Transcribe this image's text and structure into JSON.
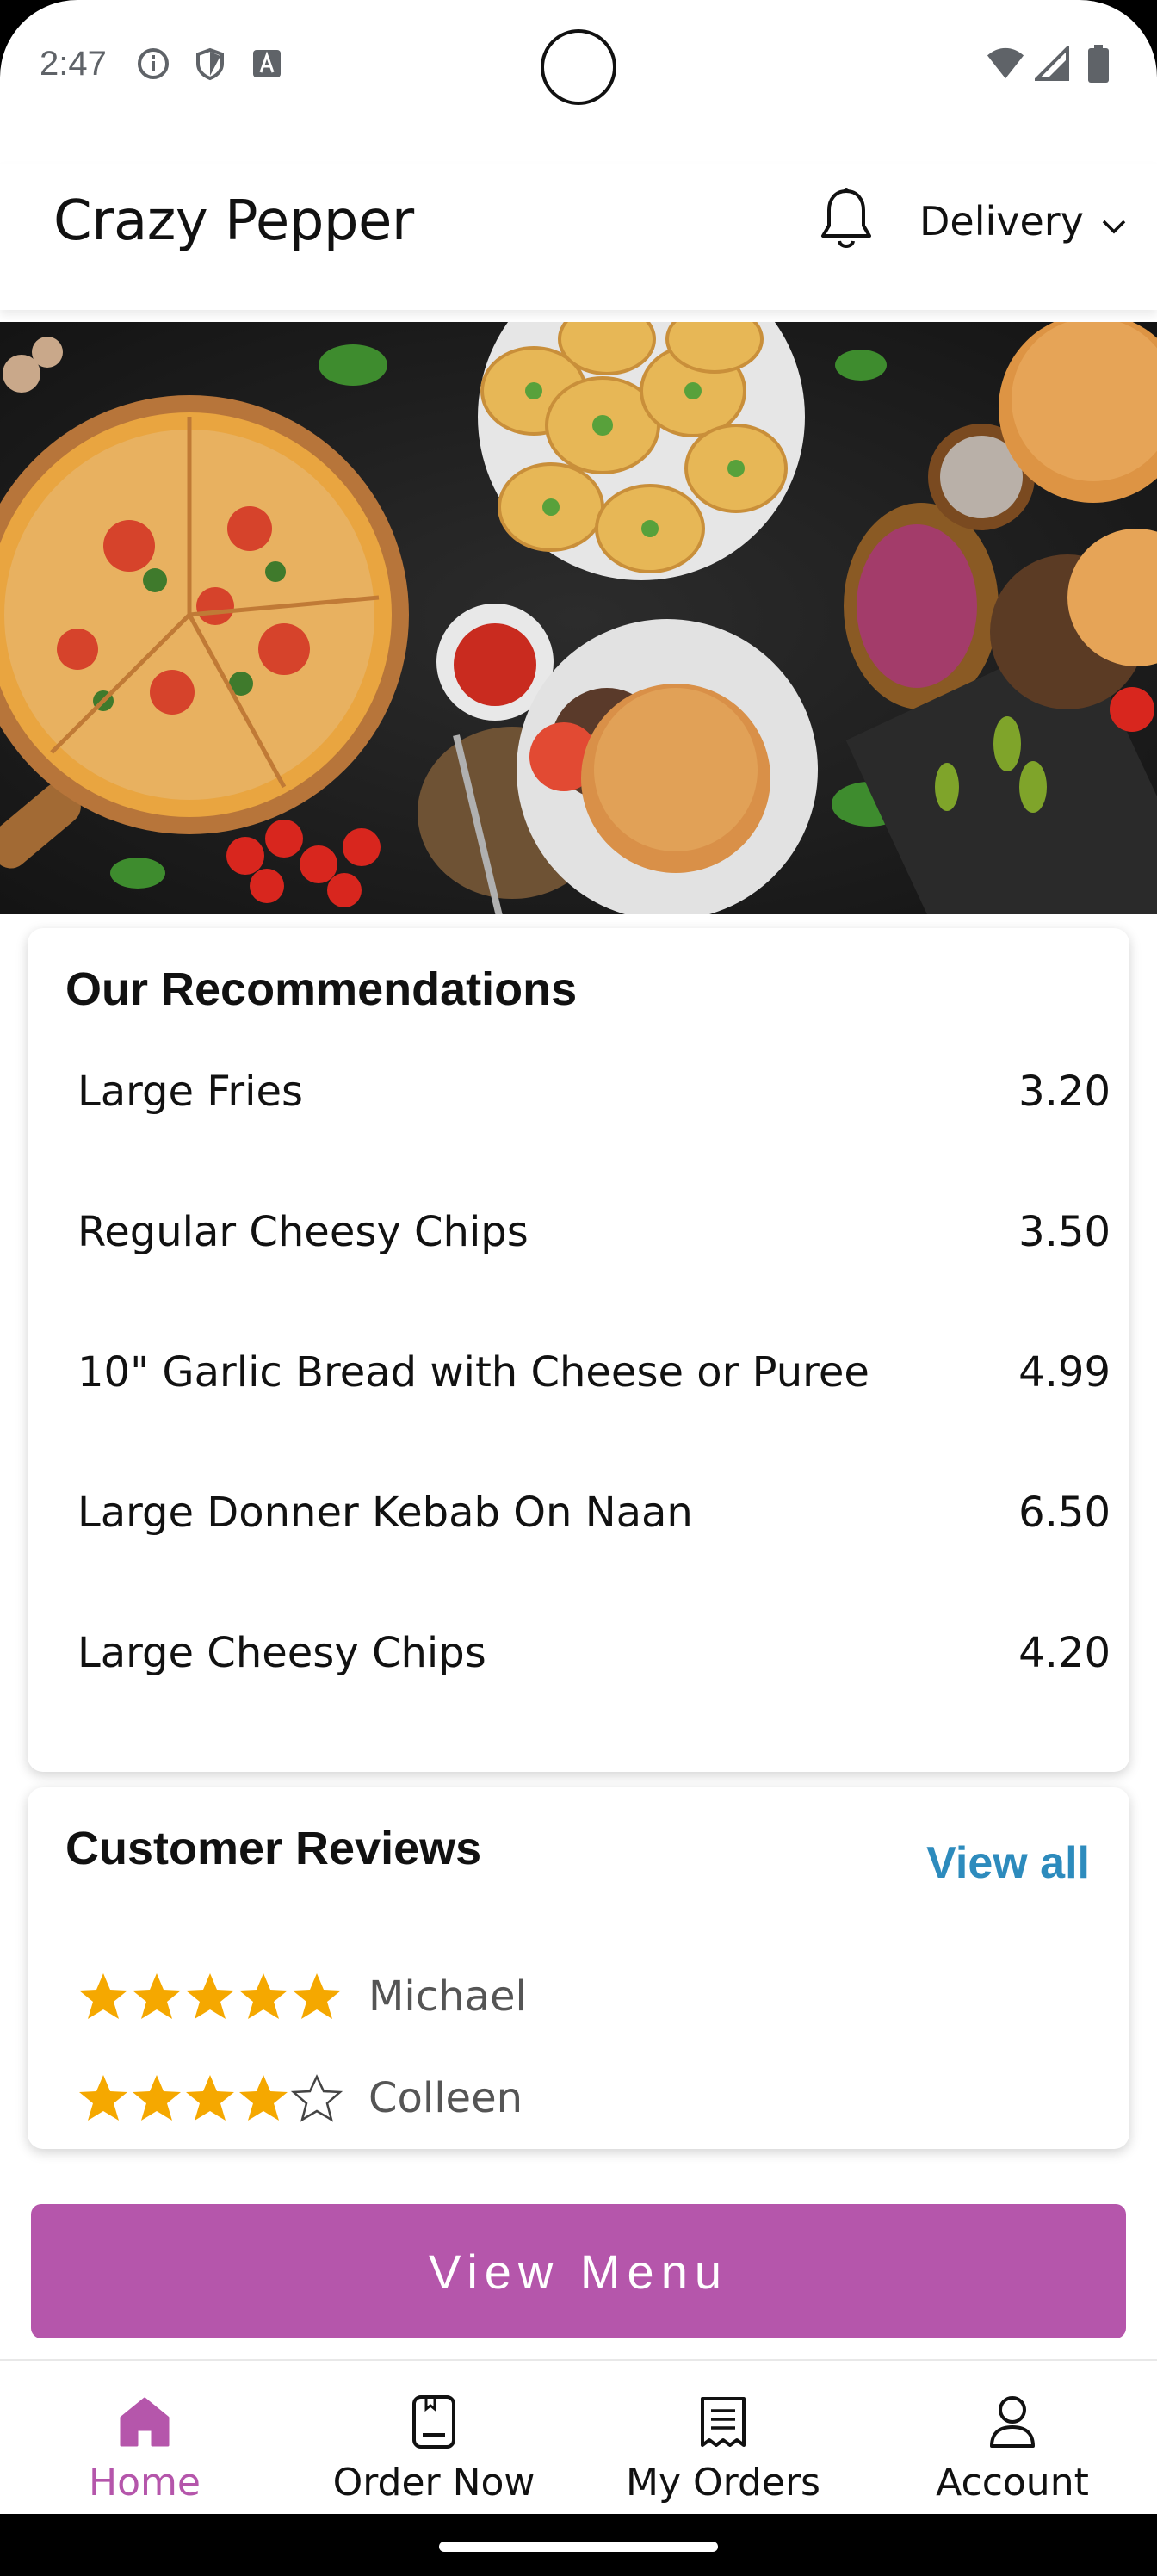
{
  "status_bar": {
    "time": "2:47",
    "icons_left": [
      "info-icon",
      "shield-icon",
      "keyboard-a-icon"
    ],
    "icons_right": [
      "wifi-icon",
      "signal-icon",
      "battery-icon"
    ]
  },
  "header": {
    "title": "Crazy Pepper",
    "notification_icon": "bell-icon",
    "mode_label": "Delivery",
    "mode_icon": "chevron-down-icon"
  },
  "banner": {
    "image": "food-banner-pizza-garlic-bread-burgers"
  },
  "recommendations": {
    "title": "Our Recommendations",
    "items": [
      {
        "name": "Large Fries",
        "price": "3.20"
      },
      {
        "name": "Regular Cheesy Chips",
        "price": "3.50"
      },
      {
        "name": "10\" Garlic Bread with Cheese or Puree",
        "price": "4.99"
      },
      {
        "name": "Large Donner Kebab On Naan",
        "price": "6.50"
      },
      {
        "name": "Large Cheesy Chips",
        "price": "4.20"
      }
    ]
  },
  "reviews": {
    "title": "Customer Reviews",
    "view_all": "View all",
    "items": [
      {
        "name": "Michael",
        "rating": 5
      },
      {
        "name": "Colleen",
        "rating": 4
      }
    ]
  },
  "cta": {
    "label": "View Menu"
  },
  "bottom_nav": {
    "items": [
      {
        "label": "Home",
        "icon": "home-icon",
        "active": true
      },
      {
        "label": "Order Now",
        "icon": "order-book-icon",
        "active": false
      },
      {
        "label": "My Orders",
        "icon": "receipt-icon",
        "active": false
      },
      {
        "label": "Account",
        "icon": "person-icon",
        "active": false
      }
    ]
  },
  "colors": {
    "accent": "#b556ab",
    "link": "#2d8bbd",
    "star": "#f5a800"
  }
}
